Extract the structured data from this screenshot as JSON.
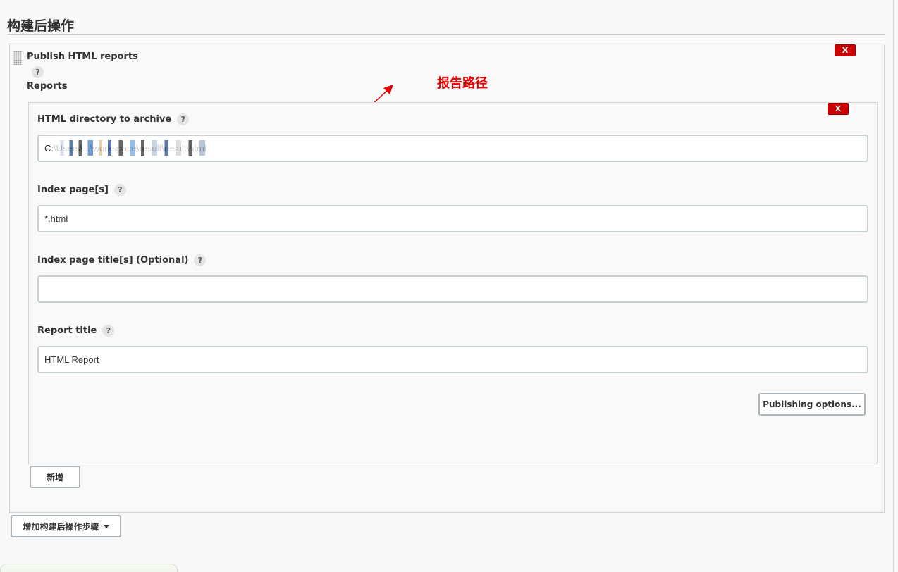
{
  "section": {
    "title": "构建后操作"
  },
  "publisher": {
    "title": "Publish HTML reports",
    "help": "?",
    "reports_label": "Reports",
    "delete_label": "X"
  },
  "annotation": {
    "text": "报告路径",
    "color": "#e60000"
  },
  "report": {
    "delete_label": "X",
    "fields": {
      "directory": {
        "label": "HTML directory to archive",
        "help": "?",
        "value": "C:\\Users\\...\\workspace\\result\\result\\html"
      },
      "index_pages": {
        "label": "Index page[s]",
        "help": "?",
        "value": "*.html"
      },
      "index_titles": {
        "label": "Index page title[s] (Optional)",
        "help": "?",
        "value": ""
      },
      "report_title": {
        "label": "Report title",
        "help": "?",
        "value": "HTML Report"
      }
    },
    "publishing_options_label": "Publishing options..."
  },
  "buttons": {
    "add_label": "新增",
    "add_step_label": "增加构建后操作步骤"
  },
  "icons": {
    "help": "help-icon",
    "drag": "drag-handle-icon",
    "caret": "caret-down-icon"
  }
}
